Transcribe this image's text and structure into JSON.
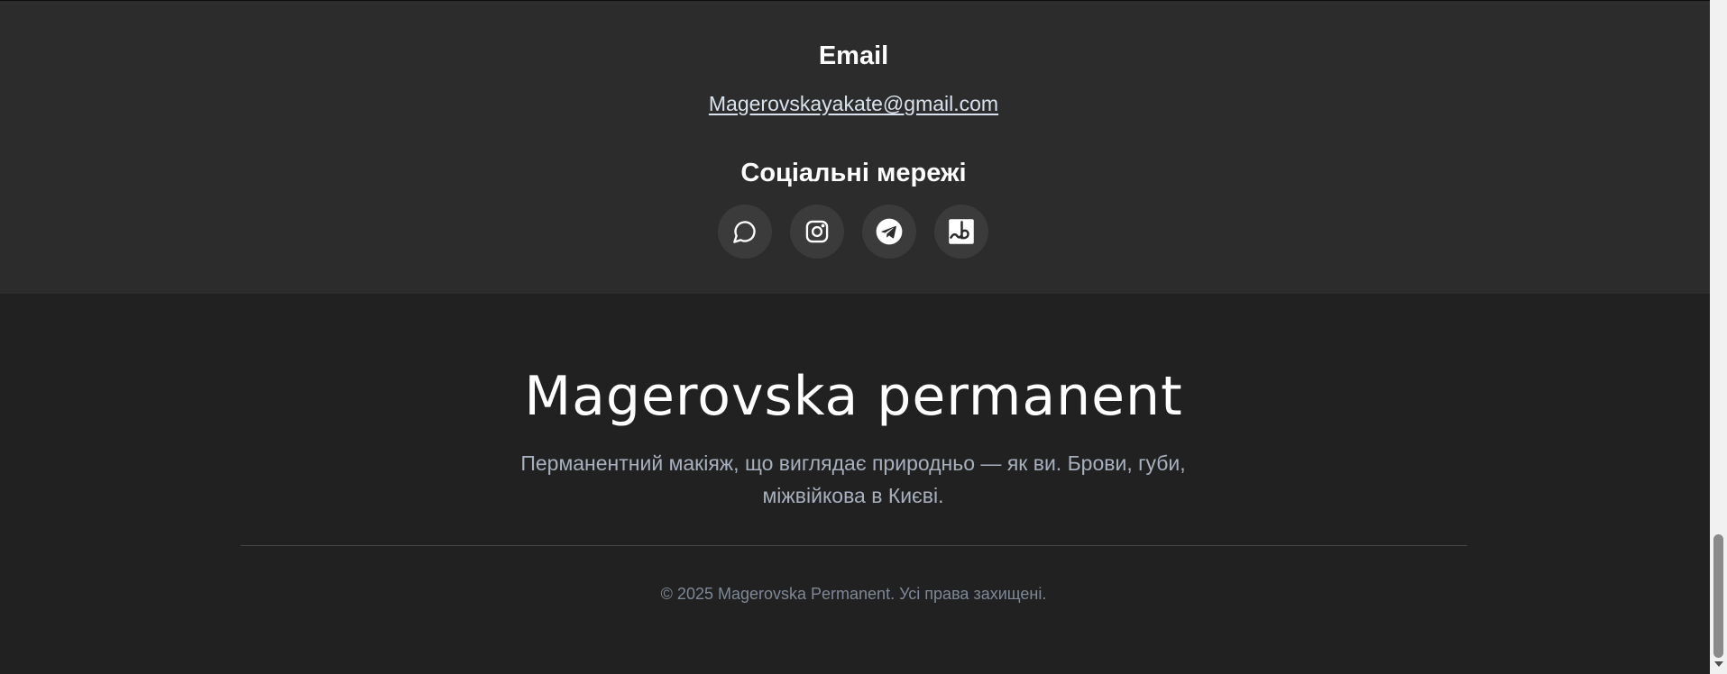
{
  "contact": {
    "email_heading": "Email",
    "email_address": "Magerovskayakate@gmail.com",
    "social_heading": "Соціальні мережі",
    "social_links": [
      {
        "icon": "chat-bubble-icon"
      },
      {
        "icon": "instagram-icon"
      },
      {
        "icon": "telegram-icon"
      },
      {
        "icon": "booking-icon"
      }
    ]
  },
  "footer": {
    "brand": "Magerovska permanent",
    "description": "Перманентний макіяж, що виглядає природньо — як ви. Брови, губи, міжвійкова в Києві.",
    "copyright": "© 2025 Magerovska Permanent. Усі права захищені."
  },
  "colors": {
    "contact_background": "#2c2c2c",
    "footer_background": "#212121",
    "icon_button_background": "#3b3b3b",
    "heading_text": "#ffffff",
    "description_text": "#a8b0bd",
    "copyright_text": "#7f8896"
  }
}
